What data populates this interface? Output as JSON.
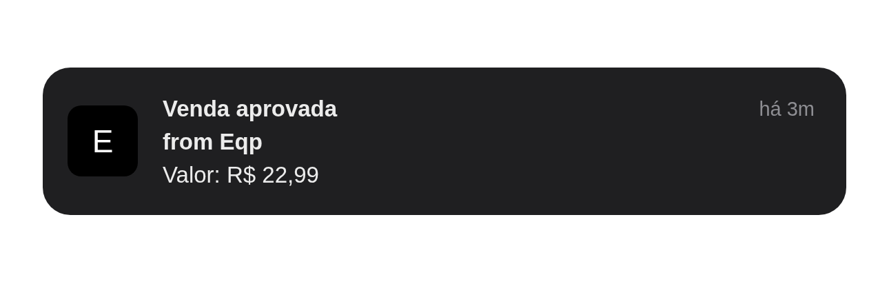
{
  "notification": {
    "app_icon_letter": "E",
    "title": "Venda aprovada",
    "subtitle": "from Eqp",
    "body": "Valor: R$ 22,99",
    "time": "há 3m"
  }
}
